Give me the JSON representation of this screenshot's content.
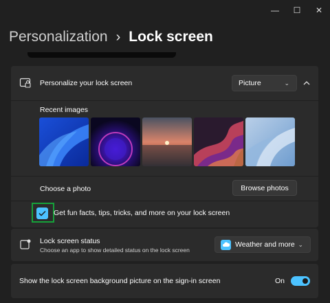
{
  "window": {
    "minimize_glyph": "—",
    "maximize_glyph": "☐",
    "close_glyph": "✕"
  },
  "header": {
    "breadcrumb": "Personalization",
    "separator": "›",
    "title": "Lock screen"
  },
  "personalize": {
    "label": "Personalize your lock screen",
    "dropdown_value": "Picture",
    "recent_images_label": "Recent images",
    "recent_images": [
      "windows-bloom-blue",
      "windows-glow-purple",
      "sunset-lake",
      "ribbon-swirl",
      "windows-light-blue"
    ],
    "choose_photo_label": "Choose a photo",
    "browse_button": "Browse photos",
    "fun_facts_label": "Get fun facts, tips, tricks, and more on your lock screen",
    "fun_facts_checked": true
  },
  "status": {
    "label": "Lock screen status",
    "description": "Choose an app to show detailed status on the lock screen",
    "dropdown_value": "Weather and more"
  },
  "signin": {
    "label": "Show the lock screen background picture on the sign-in screen",
    "toggle_state": "On",
    "toggle_on": true
  },
  "colors": {
    "accent": "#4cc2ff",
    "highlight": "#16a23a",
    "background": "#202020",
    "card": "#2b2b2b"
  }
}
